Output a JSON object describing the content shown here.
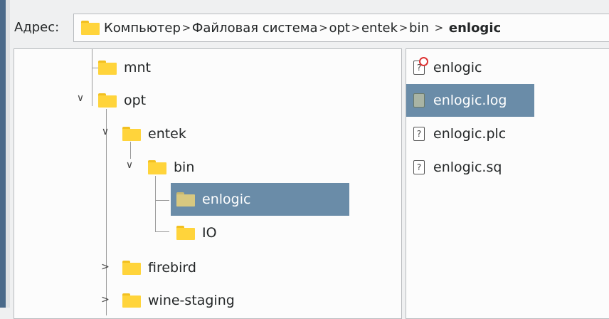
{
  "address": {
    "label": "Адрес:",
    "crumbs": [
      "Компьютер",
      "Файловая система",
      "opt",
      "entek",
      "bin",
      "enlogic"
    ],
    "separator": ">"
  },
  "tree": {
    "mnt": "mnt",
    "opt": "opt",
    "entek": "entek",
    "bin": "bin",
    "enlogic": "enlogic",
    "io": "IO",
    "firebird": "firebird",
    "wine_staging": "wine-staging",
    "expanded_arrow": "∨",
    "collapsed_arrow": ">"
  },
  "files": [
    {
      "name": "enlogic",
      "icon": "unknown-file-icon-with-badge"
    },
    {
      "name": "enlogic.log",
      "icon": "log-file-icon"
    },
    {
      "name": "enlogic.plc",
      "icon": "unknown-file-icon"
    },
    {
      "name": "enlogic.sq",
      "icon": "unknown-file-icon"
    }
  ],
  "colors": {
    "selection": "#6a8ca8",
    "folder": "#ffd43b",
    "window_edge": "#4a6a8a"
  }
}
